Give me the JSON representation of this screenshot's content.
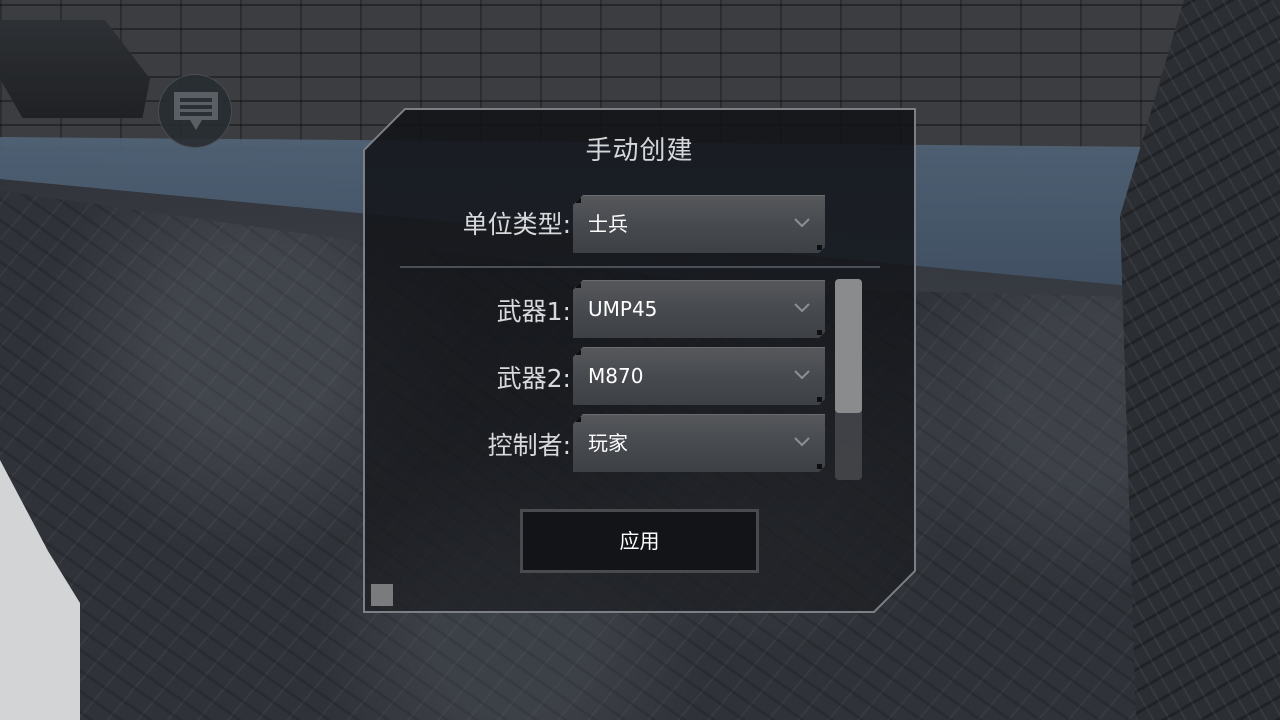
{
  "dialog": {
    "title": "手动创建",
    "fields": [
      {
        "label": "单位类型:",
        "value": "士兵"
      },
      {
        "label": "武器1:",
        "value": "UMP45"
      },
      {
        "label": "武器2:",
        "value": "M870"
      },
      {
        "label": "控制者:",
        "value": "玩家"
      }
    ],
    "apply_label": "应用",
    "scroll_position": 0
  },
  "icons": {
    "chat": "chat-bubble-icon",
    "dropdown": "chevron-down-icon"
  },
  "colors": {
    "dialog_border": "#7c7f85",
    "select_bg": "#4a4d51",
    "text": "#ffffff"
  }
}
